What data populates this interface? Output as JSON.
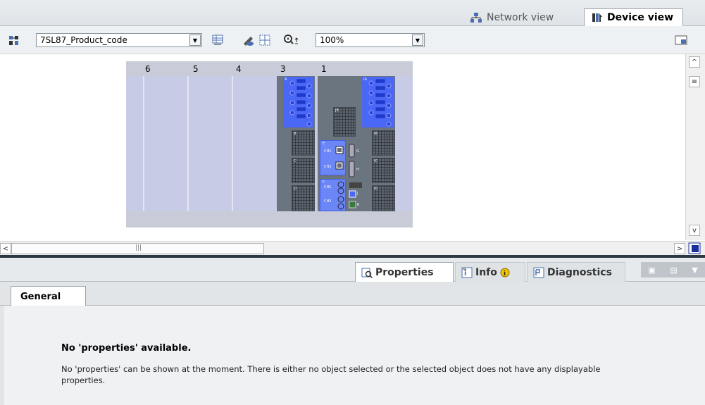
{
  "view_tabs": {
    "network_view": "Network view",
    "device_view": "Device view"
  },
  "toolbar": {
    "device_select_value": "7SL87_Product_code",
    "zoom_value": "100%",
    "icons": [
      "network-overview-icon",
      "device-table-icon",
      "show-hide-icon",
      "grid-icon",
      "zoom-icon"
    ]
  },
  "rack": {
    "slot_numbers": [
      "6",
      "5",
      "4",
      "3",
      "1"
    ]
  },
  "module_labels": {
    "a": "A",
    "b": "B",
    "c": "C",
    "d": "D",
    "ia": "IA",
    "ib": "IB",
    "ic": "IC",
    "id": "ID",
    "jb": "JB",
    "e": "E",
    "f": "F",
    "g": "G",
    "h": "H",
    "j": "J",
    "k": "K",
    "ch1": "CH1",
    "ch2": "CH2"
  },
  "properties_pane": {
    "tabs": {
      "properties": "Properties",
      "info": "Info",
      "diagnostics": "Diagnostics"
    },
    "sub_tab": "General",
    "message_title": "No 'properties' available.",
    "message_text": "No 'properties' can be shown at the moment. There is either no object selected or the selected object does not have any displayable properties."
  },
  "colors": {
    "module_blue": "#4b67f5",
    "rack_bg": "#c7cbe6",
    "module_gray": "#6b7580",
    "info_badge": "#f2c400"
  }
}
